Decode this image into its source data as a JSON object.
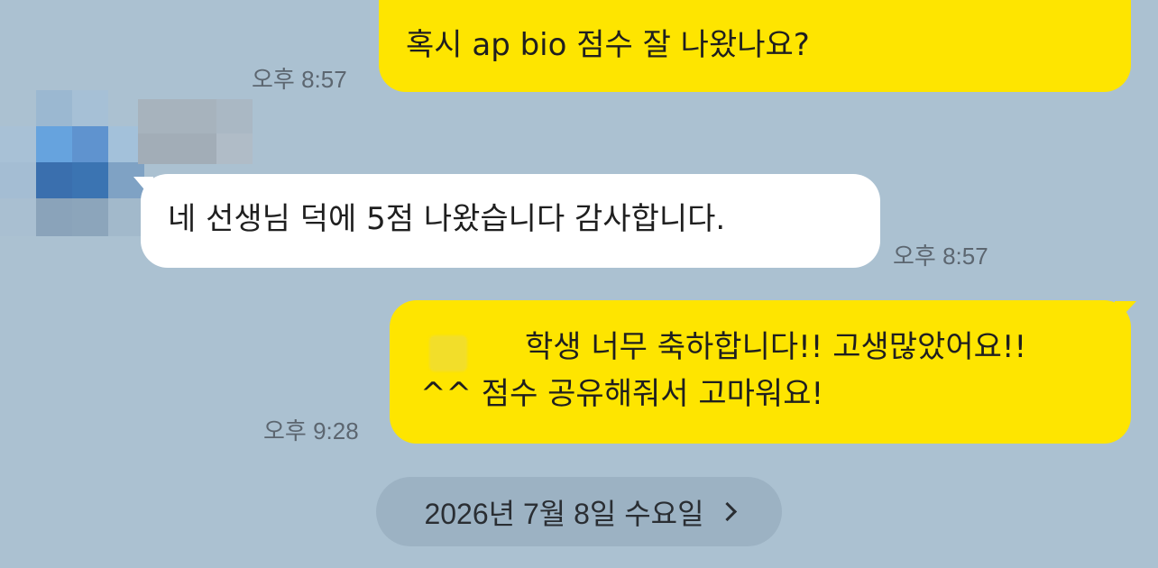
{
  "colors": {
    "background": "#abc1d1",
    "mine_bubble": "#fee500",
    "theirs_bubble": "#ffffff",
    "time_text": "#5c6670",
    "date_pill": "#9cb2c3"
  },
  "messages": [
    {
      "sender": "me",
      "text": "혹시 ap bio 점수 잘 나왔나요?",
      "time": "오후 8:57"
    },
    {
      "sender": "other",
      "text": "네 선생님 덕에 5점 나왔습니다 감사합니다.",
      "time": "오후 8:57"
    },
    {
      "sender": "me",
      "lines": [
        "학생 너무 축하합니다!! 고생많았어요!!",
        "^^ 점수 공유해줘서 고마워요!"
      ],
      "time": "오후 9:28"
    }
  ],
  "date_divider": {
    "label": "2026년 7월 8일 수요일",
    "icon": "chevron-right-icon"
  }
}
